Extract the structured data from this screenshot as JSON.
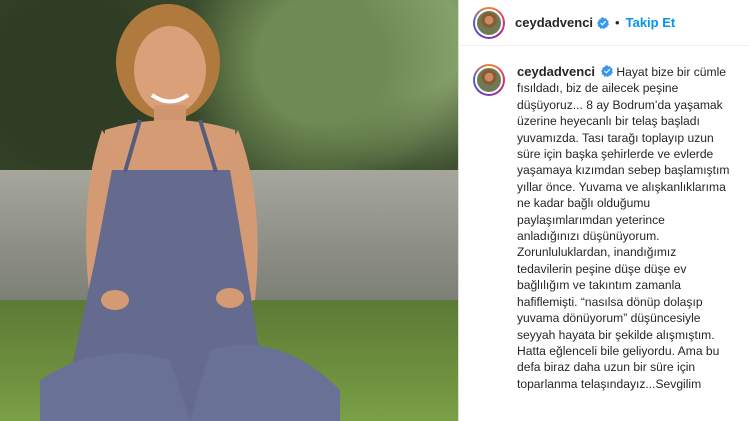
{
  "post": {
    "username": "ceydadvenci",
    "follow_label": "Takip Et",
    "separator": "•"
  },
  "caption": {
    "first_line": "Hayat bize bir cümle",
    "lines": [
      "fısıldadı, biz de ailecek peşine",
      "düşüyoruz... 8 ay Bodrum’da yaşamak",
      "üzerine heyecanlı bir telaş başladı",
      "yuvamızda. Tası tarağı toplayıp uzun",
      "süre için başka şehirlerde ve evlerde",
      "yaşamaya kızımdan sebep başlamıştım",
      "yıllar önce. Yuvama ve alışkanlıklarıma",
      "ne kadar bağlı olduğumu",
      "paylaşımlarımdan yeterince",
      "anladığınızı düşünüyorum.",
      "Zorunluluklardan, inandığımız",
      "tedavilerin peşine düşe düşe ev",
      "bağlılığım ve takıntım zamanla",
      "hafiflemişti. “nasılsa dönüp dolaşıp",
      "yuvama dönüyorum” düşüncesiyle",
      "seyyah hayata bir şekilde alışmıştım.",
      "Hatta eğlenceli bile geliyordu. Ama bu",
      "defa biraz daha uzun bir süre için",
      "toparlanma telaşındayız...Sevgilim"
    ]
  },
  "icons": {
    "verified": "verified-badge-icon"
  },
  "colors": {
    "link_blue": "#0095f6",
    "verified_blue": "#3897f0",
    "text": "#262626",
    "border": "#dbdbdb"
  }
}
